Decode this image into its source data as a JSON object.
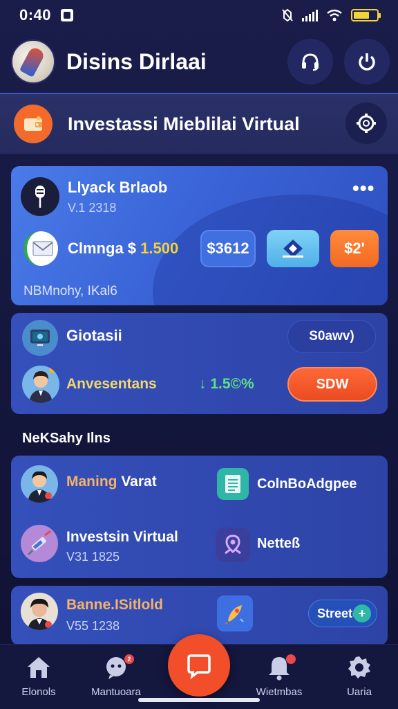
{
  "status_bar": {
    "time": "0:40"
  },
  "header": {
    "title": "Disins Dirlaai"
  },
  "banner": {
    "title": "Investassi Mieblilai Virtual"
  },
  "card_account": {
    "title": "Llyack Brlaob",
    "subtitle": "V.1 2318",
    "balance_label": "Clmnga $",
    "balance_amount": "1.500",
    "pill_a": "$3612",
    "pill_c": "$2'",
    "footer": "NBMnohy, IKal6"
  },
  "card_portfolio": {
    "title": "Giotasii",
    "outline_button": "S0awv)",
    "name": "Anvesentans",
    "rate": "↓ 1.5©%",
    "solid_button": "SDW"
  },
  "section": {
    "title": "NeKSahy Ilns"
  },
  "list_card": {
    "item1_prefix": "Maning",
    "item1_rest": " Varat",
    "item2": "ColnBoAdgpee",
    "item3_title": "Investsin Virtual",
    "item3_sub": "V31 1825",
    "item4": "Netteß"
  },
  "card_bottom": {
    "title": "Banne.ISitlold",
    "sub": "V55 1238",
    "button": "Streete"
  },
  "bottom_nav": {
    "items": [
      {
        "label": "Elonols"
      },
      {
        "label": "Mantuoara"
      },
      {
        "label": "Wietmbas"
      },
      {
        "label": "Uaria"
      }
    ]
  },
  "colors": {
    "accent_orange": "#f24e2a",
    "accent_yellow": "#f2d33a",
    "accent_green": "#5fe08a",
    "card_blue": "#3550bb"
  }
}
